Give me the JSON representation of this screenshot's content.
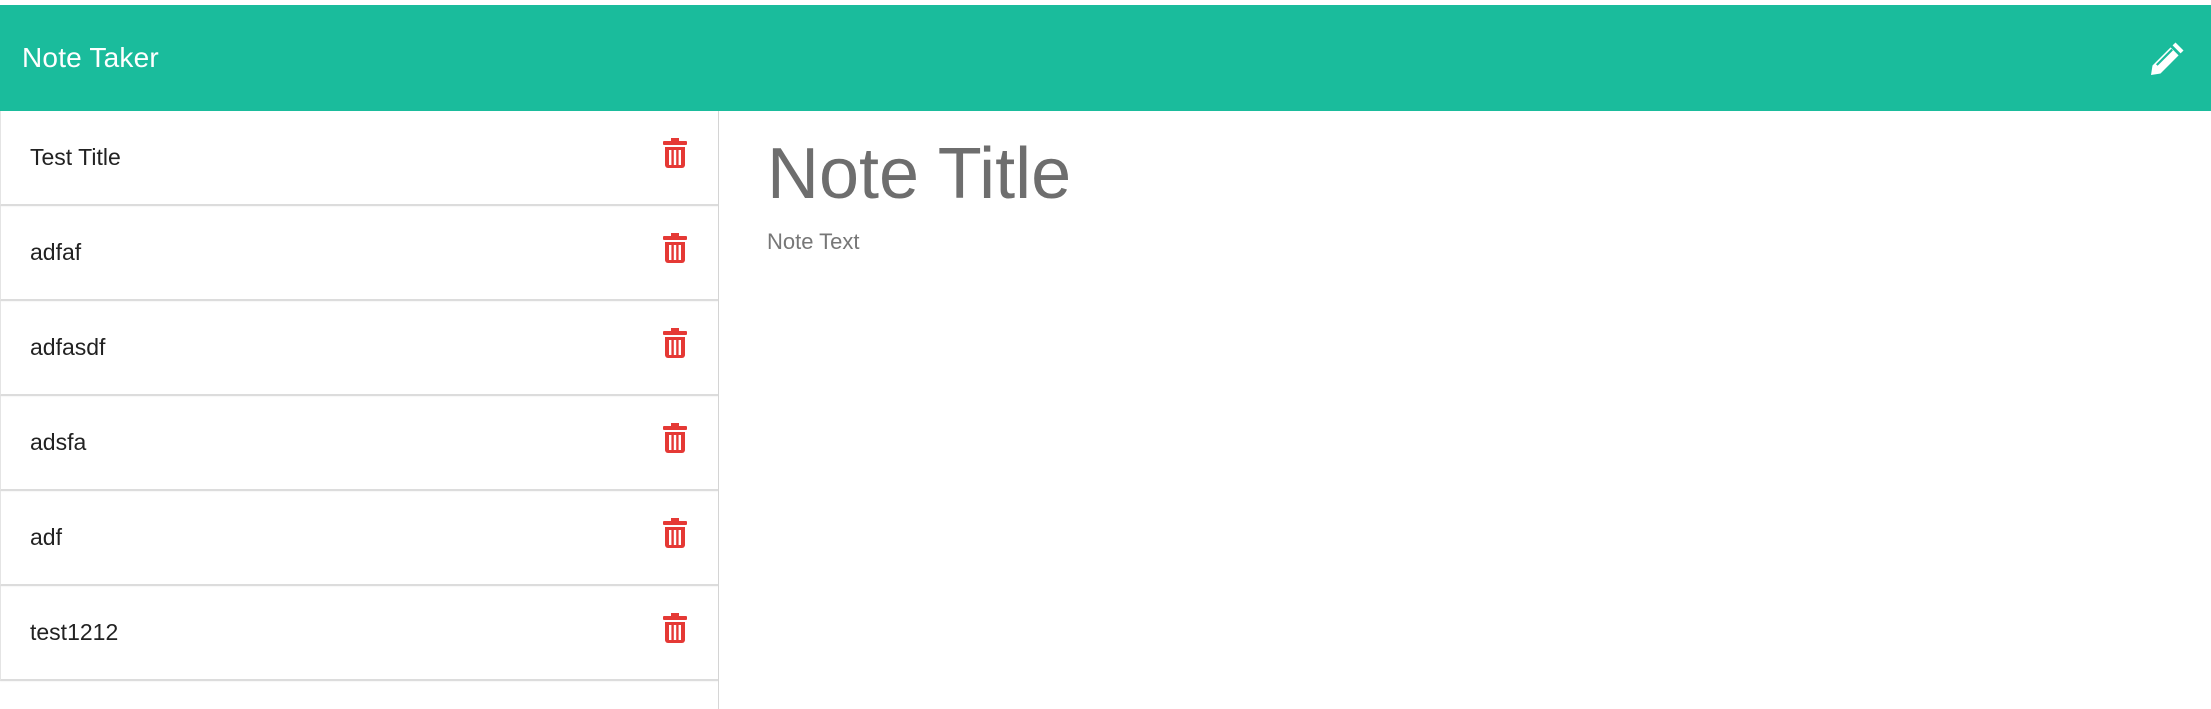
{
  "app": {
    "brand": "Note Taker",
    "accent_color": "#1abc9c",
    "delete_color": "#e53935"
  },
  "header": {
    "new_note_icon": "pencil-icon"
  },
  "notes": [
    {
      "title": "Test Title",
      "delete_icon": "trash-icon"
    },
    {
      "title": "adfaf",
      "delete_icon": "trash-icon"
    },
    {
      "title": "adfasdf",
      "delete_icon": "trash-icon"
    },
    {
      "title": "adsfa",
      "delete_icon": "trash-icon"
    },
    {
      "title": "adf",
      "delete_icon": "trash-icon"
    },
    {
      "title": "test1212",
      "delete_icon": "trash-icon"
    }
  ],
  "editor": {
    "title_placeholder": "Note Title",
    "text_placeholder": "Note Text"
  }
}
